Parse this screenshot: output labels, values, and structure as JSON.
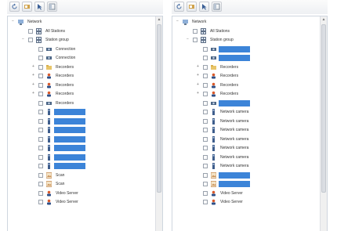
{
  "panels": [
    {
      "id": "left",
      "toolbar": [
        {
          "icon": "refresh-icon"
        },
        {
          "icon": "camera-icon"
        },
        {
          "icon": "cursor-icon"
        },
        {
          "icon": "panel-icon"
        }
      ],
      "rows": [
        {
          "depth": 0,
          "expander": "−",
          "check": false,
          "icon": "root-icon",
          "label": "Network",
          "selected": false
        },
        {
          "depth": 1,
          "expander": "",
          "check": true,
          "icon": "grid-icon",
          "label": "All Stations",
          "selected": false
        },
        {
          "depth": 1,
          "expander": "−",
          "check": true,
          "icon": "grid-icon",
          "label": "Station group",
          "selected": false
        },
        {
          "depth": 2,
          "expander": "",
          "check": true,
          "icon": "camera-icon",
          "label": "Connection",
          "selected": false
        },
        {
          "depth": 2,
          "expander": "",
          "check": true,
          "icon": "camera-icon",
          "label": "Connection",
          "selected": false
        },
        {
          "depth": 2,
          "expander": "+",
          "check": true,
          "icon": "folder-icon",
          "label": "Recorders",
          "selected": false
        },
        {
          "depth": 2,
          "expander": "+",
          "check": true,
          "icon": "user-icon",
          "label": "Recorders",
          "selected": false
        },
        {
          "depth": 2,
          "expander": "+",
          "check": true,
          "icon": "user-icon",
          "label": "Recorders",
          "selected": false
        },
        {
          "depth": 2,
          "expander": "+",
          "check": true,
          "icon": "user-icon",
          "label": "Recorders",
          "selected": false
        },
        {
          "depth": 2,
          "expander": "",
          "check": true,
          "icon": "camera-icon",
          "label": "Recorders",
          "selected": false
        },
        {
          "depth": 2,
          "expander": "",
          "check": true,
          "icon": "device-icon",
          "label": "",
          "selected": true
        },
        {
          "depth": 2,
          "expander": "",
          "check": true,
          "icon": "device-icon",
          "label": "",
          "selected": true
        },
        {
          "depth": 2,
          "expander": "",
          "check": true,
          "icon": "device-icon",
          "label": "",
          "selected": true
        },
        {
          "depth": 2,
          "expander": "",
          "check": true,
          "icon": "device-icon",
          "label": "",
          "selected": true
        },
        {
          "depth": 2,
          "expander": "",
          "check": true,
          "icon": "device-icon",
          "label": "",
          "selected": true
        },
        {
          "depth": 2,
          "expander": "",
          "check": true,
          "icon": "device-icon",
          "label": "",
          "selected": true
        },
        {
          "depth": 2,
          "expander": "",
          "check": true,
          "icon": "device-icon",
          "label": "",
          "selected": true
        },
        {
          "depth": 2,
          "expander": "",
          "check": true,
          "icon": "image-icon",
          "label": "Scan",
          "selected": false
        },
        {
          "depth": 2,
          "expander": "",
          "check": true,
          "icon": "image-icon",
          "label": "Scan",
          "selected": false
        },
        {
          "depth": 2,
          "expander": "",
          "check": true,
          "icon": "user-icon",
          "label": "Video Server",
          "selected": false
        },
        {
          "depth": 2,
          "expander": "",
          "check": true,
          "icon": "user-icon",
          "label": "Video Server",
          "selected": false
        }
      ]
    },
    {
      "id": "right",
      "toolbar": [
        {
          "icon": "refresh-icon"
        },
        {
          "icon": "camera-icon"
        },
        {
          "icon": "cursor-icon"
        },
        {
          "icon": "panel-icon"
        }
      ],
      "rows": [
        {
          "depth": 0,
          "expander": "−",
          "check": false,
          "icon": "root-icon",
          "label": "Network",
          "selected": false
        },
        {
          "depth": 1,
          "expander": "",
          "check": true,
          "icon": "grid-icon",
          "label": "All Stations",
          "selected": false
        },
        {
          "depth": 1,
          "expander": "−",
          "check": true,
          "icon": "grid-icon",
          "label": "Station group",
          "selected": false
        },
        {
          "depth": 2,
          "expander": "",
          "check": true,
          "icon": "camera-icon",
          "label": "",
          "selected": true
        },
        {
          "depth": 2,
          "expander": "",
          "check": true,
          "icon": "camera-icon",
          "label": "",
          "selected": true
        },
        {
          "depth": 2,
          "expander": "+",
          "check": true,
          "icon": "folder-icon",
          "label": "Recorders",
          "selected": false
        },
        {
          "depth": 2,
          "expander": "+",
          "check": true,
          "icon": "user-icon",
          "label": "Recorders",
          "selected": false
        },
        {
          "depth": 2,
          "expander": "+",
          "check": true,
          "icon": "user-icon",
          "label": "Recorders",
          "selected": false
        },
        {
          "depth": 2,
          "expander": "+",
          "check": true,
          "icon": "user-icon",
          "label": "Recorders",
          "selected": false
        },
        {
          "depth": 2,
          "expander": "",
          "check": true,
          "icon": "camera-icon",
          "label": "",
          "selected": true
        },
        {
          "depth": 2,
          "expander": "",
          "check": true,
          "icon": "device-icon",
          "label": "Network camera",
          "selected": false
        },
        {
          "depth": 2,
          "expander": "",
          "check": true,
          "icon": "device-icon",
          "label": "Network camera",
          "selected": false
        },
        {
          "depth": 2,
          "expander": "",
          "check": true,
          "icon": "device-icon",
          "label": "Network camera",
          "selected": false
        },
        {
          "depth": 2,
          "expander": "",
          "check": true,
          "icon": "device-icon",
          "label": "Network camera",
          "selected": false
        },
        {
          "depth": 2,
          "expander": "",
          "check": true,
          "icon": "device-icon",
          "label": "Network camera",
          "selected": false
        },
        {
          "depth": 2,
          "expander": "",
          "check": true,
          "icon": "device-icon",
          "label": "Network camera",
          "selected": false
        },
        {
          "depth": 2,
          "expander": "",
          "check": true,
          "icon": "device-icon",
          "label": "Network camera",
          "selected": false
        },
        {
          "depth": 2,
          "expander": "",
          "check": true,
          "icon": "image-icon",
          "label": "",
          "selected": true
        },
        {
          "depth": 2,
          "expander": "",
          "check": true,
          "icon": "image-icon",
          "label": "",
          "selected": true
        },
        {
          "depth": 2,
          "expander": "",
          "check": true,
          "icon": "user-icon",
          "label": "Video Server",
          "selected": false
        },
        {
          "depth": 2,
          "expander": "",
          "check": true,
          "icon": "user-icon",
          "label": "Video Server",
          "selected": false
        }
      ]
    }
  ],
  "colors": {
    "selection": "#3c84d8",
    "toolbar_icon": "#4a6fa5"
  }
}
